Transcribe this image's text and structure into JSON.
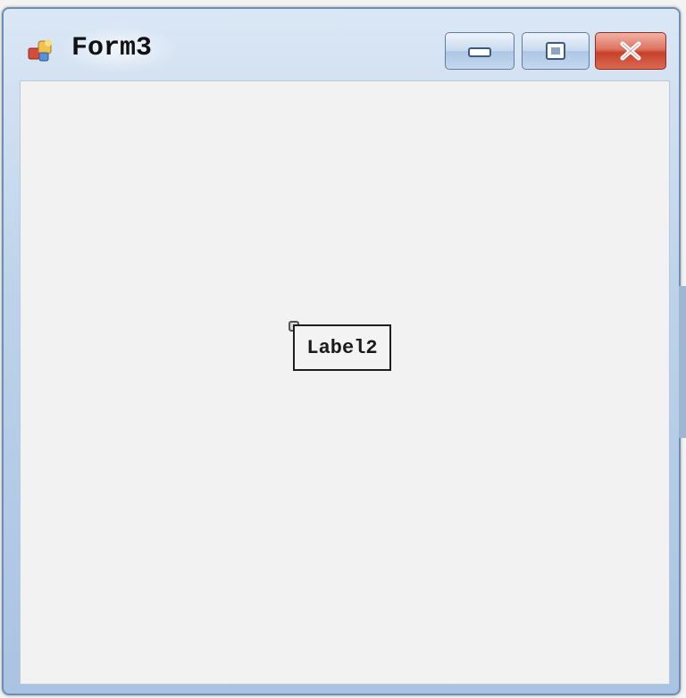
{
  "window": {
    "title": "Form3"
  },
  "title_buttons": {
    "minimize_icon": "minimize-icon",
    "maximize_icon": "maximize-icon",
    "close_icon": "close-icon"
  },
  "form": {
    "label_text": "Label2"
  },
  "colors": {
    "client_background": "#f2f2f2",
    "title_bar": "#bed3ea",
    "close_button": "#c8412b"
  }
}
